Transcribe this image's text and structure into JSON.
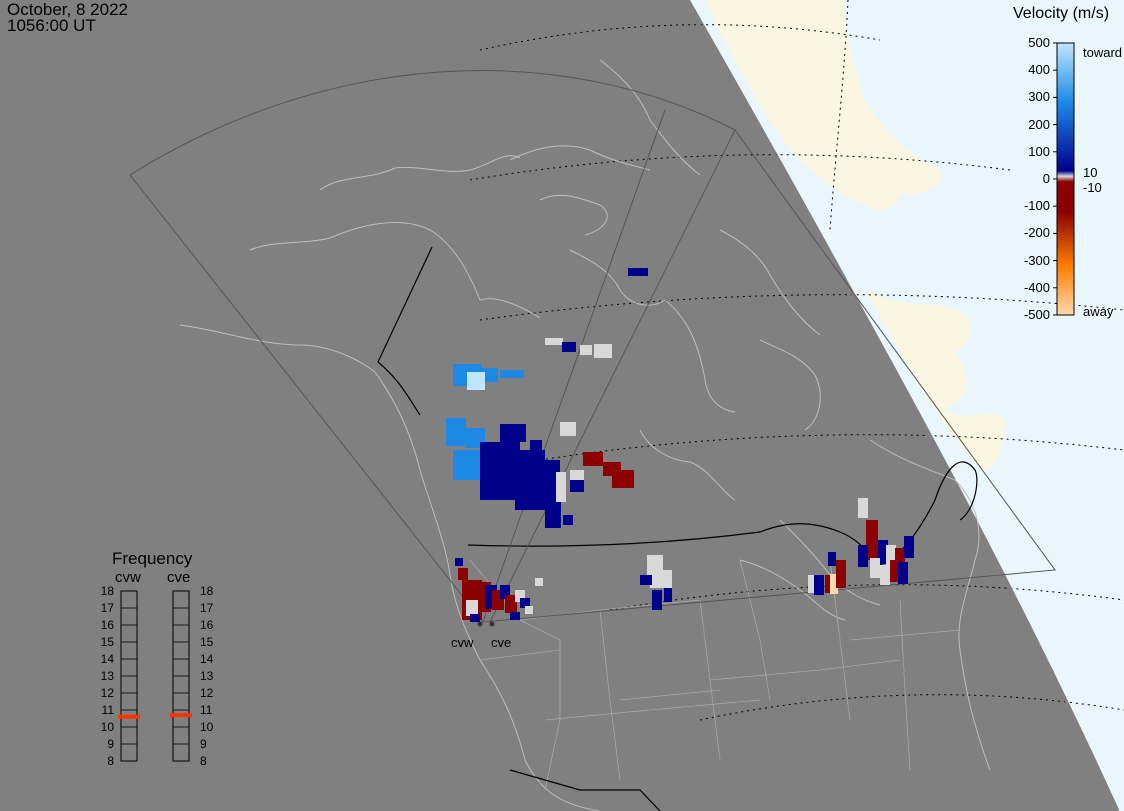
{
  "header": {
    "date": "October, 8 2022",
    "time": "1056:00 UT"
  },
  "velocity_scale": {
    "title": "Velocity (m/s)",
    "labels": [
      "500",
      "400",
      "300",
      "200",
      "100",
      "0",
      "-100",
      "-200",
      "-300",
      "-400",
      "-500"
    ],
    "extra_labels": [
      "10",
      "-10"
    ],
    "toward_label": "toward",
    "away_label": "away",
    "colors": {
      "toward_light": "#bfe6ff",
      "toward_mid": "#1e88e5",
      "toward_dark": "#00008b",
      "near_zero": "#d8d8d8",
      "away_dark": "#8b0000",
      "away_mid": "#ff7f00",
      "away_light": "#ffd9b0"
    }
  },
  "radars": [
    {
      "name": "cvw",
      "frequency_mhz": 10.6
    },
    {
      "name": "cve",
      "frequency_mhz": 10.7
    }
  ],
  "frequency_panel": {
    "title": "Frequency",
    "col_labels": [
      "cvw",
      "cve"
    ],
    "scale": [
      "18",
      "17",
      "16",
      "15",
      "14",
      "13",
      "12",
      "11",
      "10",
      "9",
      "8"
    ],
    "marker_color": "#ff3300"
  },
  "map_colors": {
    "night": "#808080",
    "day_land": "#faf6e2",
    "day_ocean": "#eaf6fd",
    "coastline": "#bdbdbd",
    "country_border": "#000000"
  }
}
